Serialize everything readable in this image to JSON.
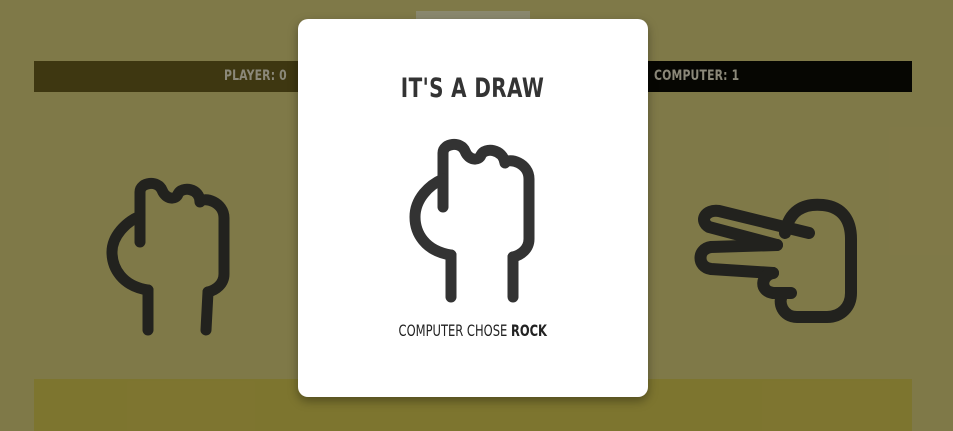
{
  "scoreboard": {
    "player_label": "PLAYER: 0",
    "computer_label": "COMPUTER: 1"
  },
  "hands": {
    "player": "rock-icon",
    "computer": "scissors-icon"
  },
  "result_modal": {
    "title": "IT'S A DRAW",
    "caption_prefix": "COMPUTER CHOSE",
    "computer_choice": "ROCK",
    "choice_icon": "rock-icon"
  },
  "colors": {
    "background": "#807a4a",
    "scoreboard": "#000000",
    "modal": "#ffffff",
    "icon": "#333333"
  }
}
